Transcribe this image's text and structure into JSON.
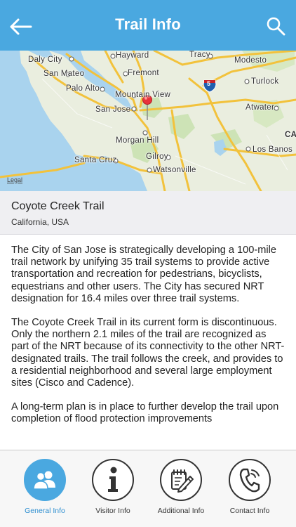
{
  "header": {
    "title": "Trail Info",
    "back_icon": "back-arrow-icon",
    "search_icon": "search-icon",
    "color": "#4aa8e0"
  },
  "map": {
    "legal": "Legal",
    "labels": {
      "daly_city": "Daly City",
      "hayward": "Hayward",
      "tracy": "Tracy",
      "modesto": "Modesto",
      "san_mateo": "San Mateo",
      "fremont": "Fremont",
      "turlock": "Turlock",
      "palo_alto": "Palo Alto",
      "mountain_view": "Mountain View",
      "san_jose": "San Jose",
      "atwater": "Atwater",
      "ca": "CA",
      "morgan_hill": "Morgan Hill",
      "gilroy": "Gilroy",
      "los_banos": "Los Banos",
      "santa_cruz": "Santa Cruz",
      "watsonville": "Watsonville",
      "interstate": "5"
    }
  },
  "trail": {
    "name": "Coyote Creek Trail",
    "location": "California, USA"
  },
  "description": {
    "p1": "The City of San Jose is strategically developing a 100-mile trail network by unifying 35 trail systems to provide active transportation and recreation for pedestrians, bicyclists, equestrians and other users. The City has secured NRT designation for 16.4 miles over three trail systems.",
    "p2": "The Coyote Creek Trail in its current form is discontinuous. Only the northern 2.1 miles of the trail are recognized as part of the NRT because of its connectivity to the other NRT-designated trails. The trail follows the creek, and provides to a residential neighborhood and several large employment sites (Cisco and Cadence).",
    "p3": "A long-term plan is in place to further develop the trail upon completion of flood protection improvements"
  },
  "tabs": [
    {
      "label": "General Info",
      "icon": "people-icon",
      "active": true
    },
    {
      "label": "Visitor Info",
      "icon": "info-icon",
      "active": false
    },
    {
      "label": "Additional Info",
      "icon": "notepad-pencil-icon",
      "active": false
    },
    {
      "label": "Contact Info",
      "icon": "phone-icon",
      "active": false
    }
  ]
}
